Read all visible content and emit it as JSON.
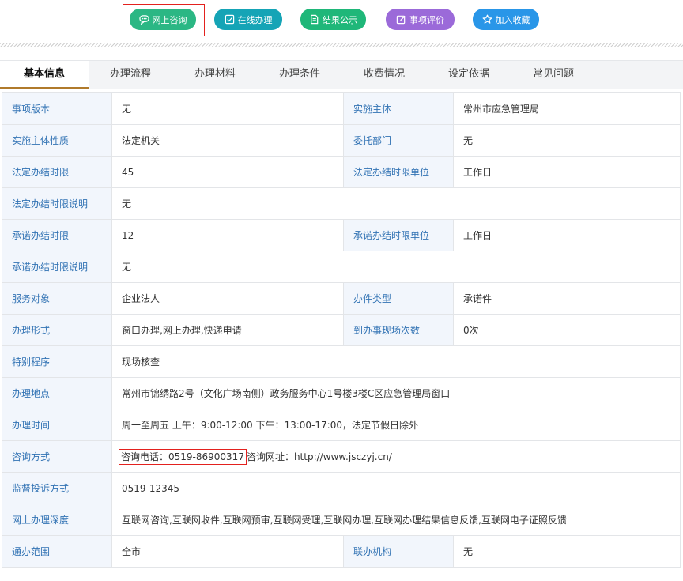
{
  "actions": {
    "online_consult": "网上咨询",
    "online_handle": "在线办理",
    "result_public": "结果公示",
    "item_review": "事项评价",
    "add_favorite": "加入收藏"
  },
  "colors": {
    "consult": "#2bb784",
    "handle": "#15a4b6",
    "result": "#1fb779",
    "review": "#9b6ad9",
    "favorite": "#2996e8",
    "highlight_border": "#e3211e",
    "label_text": "#3273b4",
    "label_bg": "#f2f6fc",
    "tab_underline": "#b07a2b"
  },
  "tabs": [
    "基本信息",
    "办理流程",
    "办理材料",
    "办理条件",
    "收费情况",
    "设定依据",
    "常见问题"
  ],
  "rows": {
    "r1": {
      "l1": "事项版本",
      "v1": "无",
      "l2": "实施主体",
      "v2": "常州市应急管理局"
    },
    "r2": {
      "l1": "实施主体性质",
      "v1": "法定机关",
      "l2": "委托部门",
      "v2": "无"
    },
    "r3": {
      "l1": "法定办结时限",
      "v1": "45",
      "l2": "法定办结时限单位",
      "v2": "工作日"
    },
    "r4": {
      "l1": "法定办结时限说明",
      "v1": "无"
    },
    "r5": {
      "l1": "承诺办结时限",
      "v1": "12",
      "l2": "承诺办结时限单位",
      "v2": "工作日"
    },
    "r6": {
      "l1": "承诺办结时限说明",
      "v1": "无"
    },
    "r7": {
      "l1": "服务对象",
      "v1": "企业法人",
      "l2": "办件类型",
      "v2": "承诺件"
    },
    "r8": {
      "l1": "办理形式",
      "v1": "窗口办理,网上办理,快递申请",
      "l2": "到办事现场次数",
      "v2": "0次"
    },
    "r9": {
      "l1": "特别程序",
      "v1": "现场核查"
    },
    "r10": {
      "l1": "办理地点",
      "v1": "常州市锦绣路2号（文化广场南侧）政务服务中心1号楼3楼C区应急管理局窗口"
    },
    "r11": {
      "l1": "办理时间",
      "v1": "周一至周五 上午：9:00-12:00 下午：13:00-17:00，法定节假日除外"
    },
    "r12": {
      "l1": "咨询方式",
      "phone": "咨询电话：0519-86900317",
      "url": "咨询网址：http://www.jsczyj.cn/"
    },
    "r13": {
      "l1": "监督投诉方式",
      "v1": "0519-12345"
    },
    "r14": {
      "l1": "网上办理深度",
      "v1": "互联网咨询,互联网收件,互联网预审,互联网受理,互联网办理,互联网办理结果信息反馈,互联网电子证照反馈"
    },
    "r15": {
      "l1": "通办范围",
      "v1": "全市",
      "l2": "联办机构",
      "v2": "无"
    }
  }
}
